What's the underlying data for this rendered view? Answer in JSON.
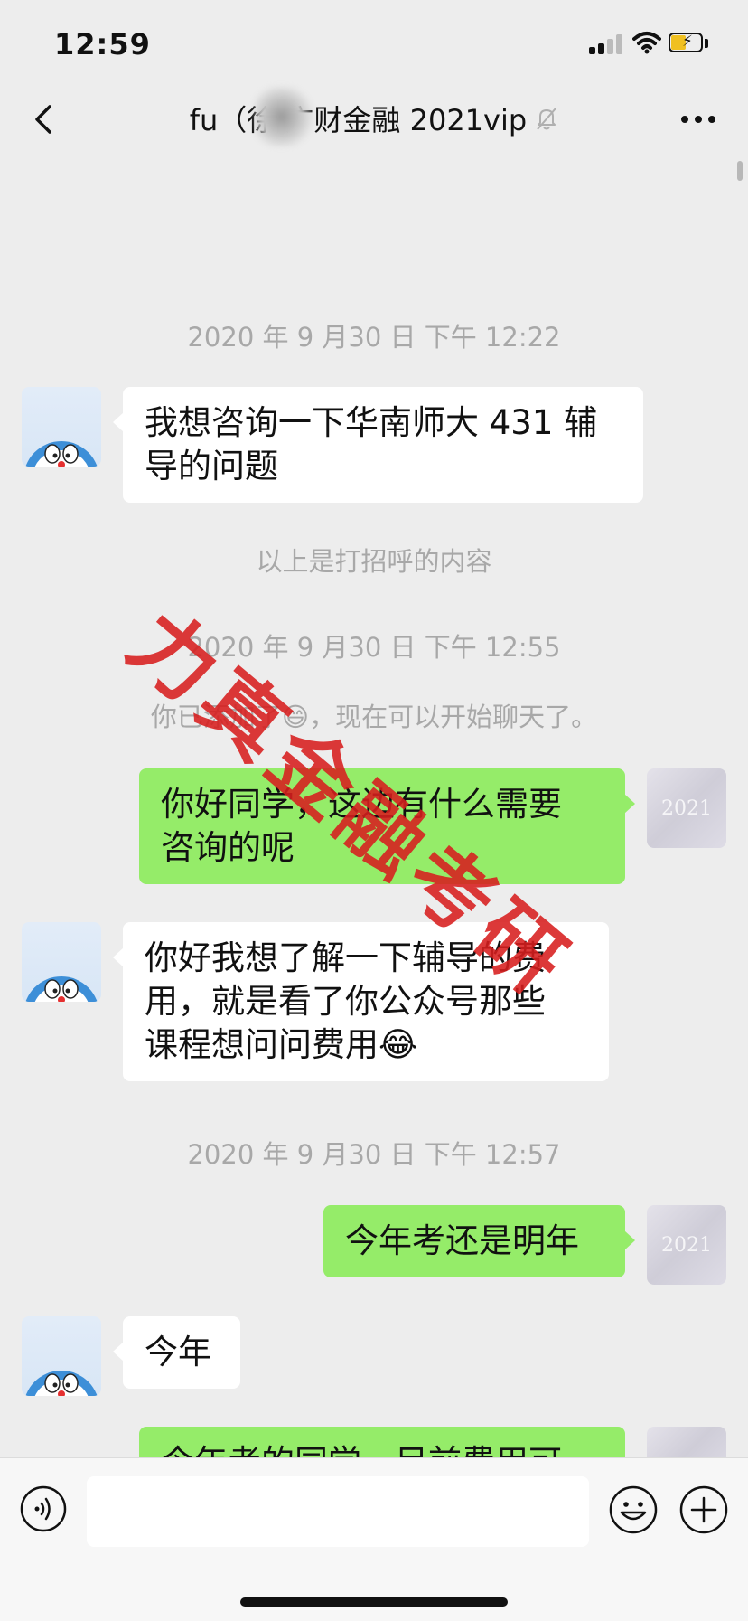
{
  "status_bar": {
    "time": "12:59"
  },
  "header": {
    "title": "fu（徐 广财金融 2021vip"
  },
  "messages": {
    "ts1": "2020 年 9 月30 日 下午 12:22",
    "m1_line1": "我想咨询一下华南师大 431 辅",
    "m1_line2": "导的问题",
    "sys1": "以上是打招呼的内容",
    "ts2": "2020 年 9 月30 日 下午 12:55",
    "sys2_before": "你已添加了",
    "sys2_emoji": "😄",
    "sys2_after": "，现在可以开始聊天了。",
    "m2_line1": "你好同学，这边有什么需要",
    "m2_line2": "咨询的呢",
    "m3_line1": "你好我想了解一下辅导的费",
    "m3_line2": "用，就是看了你公众号那些",
    "m3_line3": "课程想问问费用",
    "m3_emoji": "😂",
    "ts3": "2020 年 9 月30 日 下午 12:57",
    "m4": "今年考还是明年",
    "m5": "今年",
    "m6_partial": "今年考的同学，目前费用可"
  },
  "avatar_mark": "2021",
  "watermark": "力真金融考研",
  "input": {
    "placeholder": ""
  },
  "colors": {
    "background": "#ededed",
    "incoming_bubble": "#ffffff",
    "outgoing_bubble": "#95ec69",
    "timestamp_text": "#a8a8a8",
    "watermark": "#d81e1e",
    "battery_fill": "#f0c020"
  },
  "icons": {
    "back": "chevron-left-icon",
    "mute": "bell-off-icon",
    "more": "ellipsis-icon",
    "voice": "voice-icon",
    "emoji": "smiley-icon",
    "plus": "plus-circle-icon"
  }
}
